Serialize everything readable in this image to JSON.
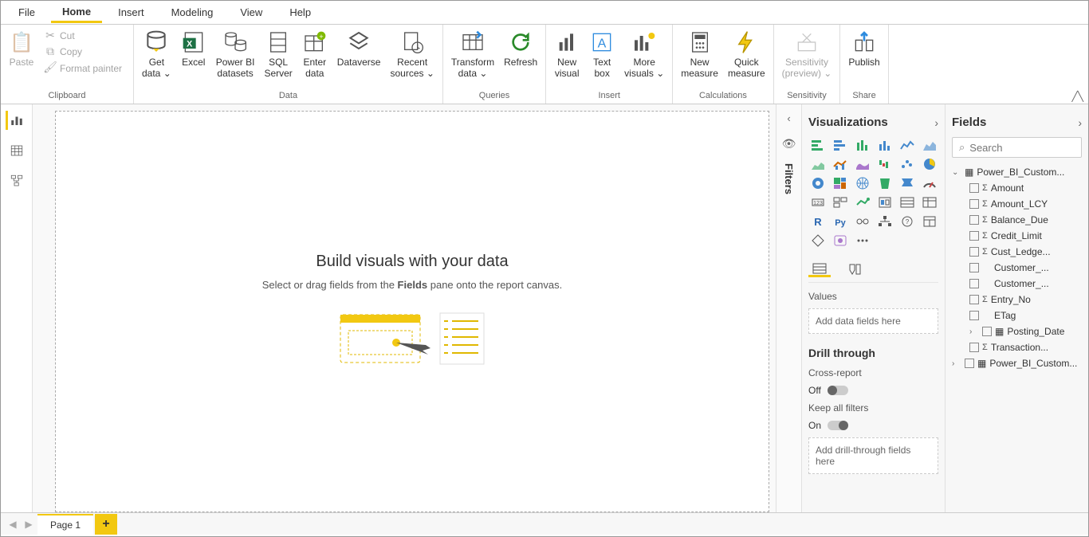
{
  "menu": {
    "tabs": [
      "File",
      "Home",
      "Insert",
      "Modeling",
      "View",
      "Help"
    ],
    "active": "Home"
  },
  "ribbon": {
    "clipboard": {
      "label": "Clipboard",
      "paste": "Paste",
      "cut": "Cut",
      "copy": "Copy",
      "format_painter": "Format painter"
    },
    "data": {
      "label": "Data",
      "get_data": "Get\ndata",
      "excel": "Excel",
      "pbi_datasets": "Power BI\ndatasets",
      "sql_server": "SQL\nServer",
      "enter_data": "Enter\ndata",
      "dataverse": "Dataverse",
      "recent_sources": "Recent\nsources"
    },
    "queries": {
      "label": "Queries",
      "transform": "Transform\ndata",
      "refresh": "Refresh"
    },
    "insert": {
      "label": "Insert",
      "new_visual": "New\nvisual",
      "text_box": "Text\nbox",
      "more_visuals": "More\nvisuals"
    },
    "calculations": {
      "label": "Calculations",
      "new_measure": "New\nmeasure",
      "quick_measure": "Quick\nmeasure"
    },
    "sensitivity": {
      "label": "Sensitivity",
      "btn": "Sensitivity\n(preview)"
    },
    "share": {
      "label": "Share",
      "publish": "Publish"
    }
  },
  "canvas": {
    "title": "Build visuals with your data",
    "subtitle_pre": "Select or drag fields from the ",
    "subtitle_bold": "Fields",
    "subtitle_post": " pane onto the report canvas."
  },
  "filters_pane": {
    "label": "Filters"
  },
  "viz_pane": {
    "title": "Visualizations",
    "values_label": "Values",
    "values_drop": "Add data fields here",
    "drill_title": "Drill through",
    "cross_report": "Cross-report",
    "off": "Off",
    "keep_filters": "Keep all filters",
    "on": "On",
    "drill_drop": "Add drill-through fields here"
  },
  "fields_pane": {
    "title": "Fields",
    "search_placeholder": "Search",
    "tables": [
      {
        "name": "Power_BI_Custom...",
        "expanded": true,
        "fields": [
          {
            "name": "Amount",
            "sigma": true
          },
          {
            "name": "Amount_LCY",
            "sigma": true
          },
          {
            "name": "Balance_Due",
            "sigma": true
          },
          {
            "name": "Credit_Limit",
            "sigma": true
          },
          {
            "name": "Cust_Ledge...",
            "sigma": true
          },
          {
            "name": "Customer_...",
            "sigma": false
          },
          {
            "name": "Customer_...",
            "sigma": false
          },
          {
            "name": "Entry_No",
            "sigma": true
          },
          {
            "name": "ETag",
            "sigma": false
          },
          {
            "name": "Posting_Date",
            "sigma": false,
            "hierarchy": true
          },
          {
            "name": "Transaction...",
            "sigma": true
          }
        ]
      },
      {
        "name": "Power_BI_Custom...",
        "expanded": false,
        "fields": []
      }
    ]
  },
  "page_tabs": {
    "page1": "Page 1"
  }
}
